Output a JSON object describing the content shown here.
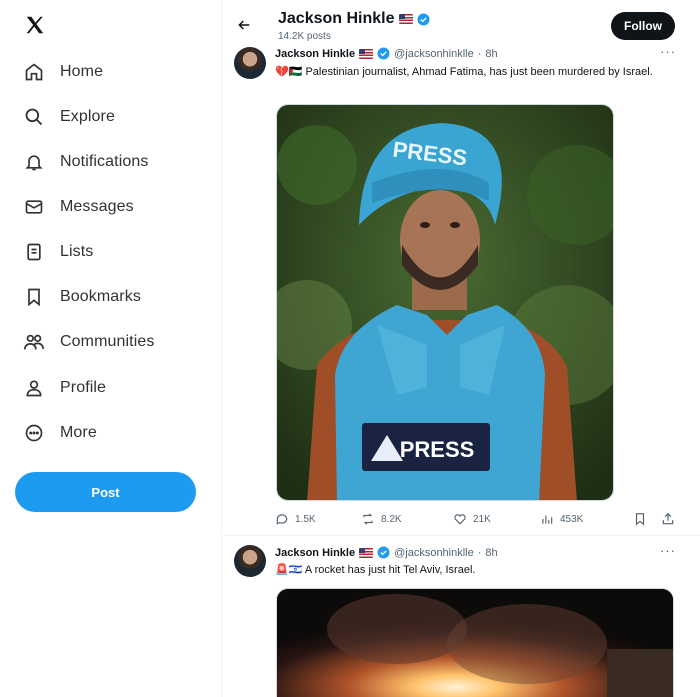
{
  "sidebar": {
    "items": [
      {
        "label": "Home",
        "icon": "home-icon"
      },
      {
        "label": "Explore",
        "icon": "search-icon"
      },
      {
        "label": "Notifications",
        "icon": "bell-icon"
      },
      {
        "label": "Messages",
        "icon": "envelope-icon"
      },
      {
        "label": "Lists",
        "icon": "list-icon"
      },
      {
        "label": "Bookmarks",
        "icon": "bookmark-icon"
      },
      {
        "label": "Communities",
        "icon": "people-icon"
      },
      {
        "label": "Profile",
        "icon": "person-icon"
      },
      {
        "label": "More",
        "icon": "more-circle-icon"
      }
    ],
    "post_label": "Post"
  },
  "header": {
    "title": "Jackson Hinkle",
    "posts_count": "14.2K posts",
    "follow_label": "Follow"
  },
  "tweets": [
    {
      "name": "Jackson Hinkle",
      "handle": "@jacksonhinklle",
      "time": "8h",
      "text": "Palestinian journalist, Ahmad Fatima, has just been murdered by Israel.",
      "emoji": "💔🇵🇸",
      "image_text": "PRESS",
      "replies": "1.5K",
      "reposts": "8.2K",
      "likes": "21K",
      "views": "453K"
    },
    {
      "name": "Jackson Hinkle",
      "handle": "@jacksonhinklle",
      "time": "8h",
      "emoji": "🚨🇮🇱",
      "text": "A rocket has just hit Tel Aviv, Israel."
    }
  ],
  "colors": {
    "accent": "#1d9bf0",
    "text": "#0f1419",
    "muted": "#536471"
  }
}
